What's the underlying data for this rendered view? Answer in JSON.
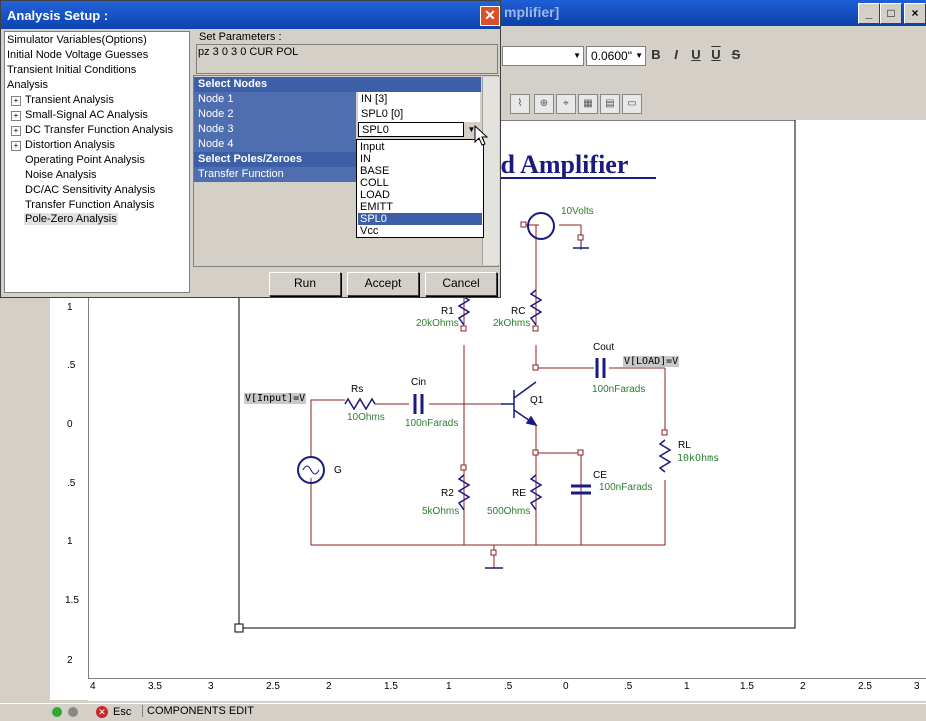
{
  "dialog": {
    "title": "Analysis Setup :",
    "close_glyph": "✕",
    "tree_items": [
      {
        "label": "Simulator Variables(Options)",
        "expandable": false
      },
      {
        "label": "Initial Node Voltage Guesses",
        "expandable": false
      },
      {
        "label": "Transient Initial Conditions",
        "expandable": false
      },
      {
        "label": "Analysis",
        "expandable": false
      },
      {
        "label": "Transient Analysis",
        "expandable": true
      },
      {
        "label": "Small-Signal AC Analysis",
        "expandable": true
      },
      {
        "label": "DC Transfer Function Analysis",
        "expandable": true
      },
      {
        "label": "Distortion Analysis",
        "expandable": true
      },
      {
        "label": "Operating Point Analysis",
        "expandable": false
      },
      {
        "label": "Noise Analysis",
        "expandable": false
      },
      {
        "label": "DC/AC Sensitivity Analysis",
        "expandable": false
      },
      {
        "label": "Transfer Function Analysis",
        "expandable": false
      },
      {
        "label": "Pole-Zero Analysis",
        "expandable": false
      }
    ],
    "set_params_label": "Set Parameters :",
    "set_params_value": "pz 3 0 3 0 CUR POL",
    "grid": {
      "select_nodes_header": "Select Nodes",
      "nodes": [
        {
          "label": "Node 1",
          "value": "IN [3]"
        },
        {
          "label": "Node 2",
          "value": "SPL0 [0]"
        },
        {
          "label": "Node 3",
          "value": "SPL0"
        },
        {
          "label": "Node 4",
          "value": ""
        }
      ],
      "poles_header": "Select Poles/Zeroes",
      "transfer_function_label": "Transfer Function"
    },
    "dropdown_options": [
      "Input",
      "IN",
      "BASE",
      "COLL",
      "LOAD",
      "EMITT",
      "SPL0",
      "Vcc"
    ],
    "dropdown_selected": "SPL0",
    "buttons": {
      "run": "Run",
      "accept": "Accept",
      "cancel": "Cancel"
    }
  },
  "editor": {
    "title_fragment": "mplifier]",
    "font_size": "0.0600\"",
    "format_buttons": [
      "B",
      "I",
      "U",
      "U",
      "S"
    ],
    "schematic_title": "ed Amplifier",
    "labels": {
      "supply": "10Volts",
      "r1_name": "R1",
      "r1_val": "20kOhms",
      "rc_name": "RC",
      "rc_val": "2kOhms",
      "cout_name": "Cout",
      "cout_val": "100nFarads",
      "vload": "V[LOAD]=V",
      "vinput": "V[Input]=V",
      "rs_name": "Rs",
      "rs_val": "10Ohms",
      "cin_name": "Cin",
      "cin_val": "100nFarads",
      "q1": "Q1",
      "rl_name": "RL",
      "rl_val": "10kOhms",
      "g": "G",
      "r2_name": "R2",
      "r2_val": "5kOhms",
      "re_name": "RE",
      "re_val": "500Ohms",
      "ce_name": "CE",
      "ce_val": "100nFarads"
    },
    "vruler": [
      "1",
      ".5",
      "0",
      ".5",
      "1",
      "1.5",
      "2"
    ],
    "hruler": [
      "4",
      "3.5",
      "3",
      "2.5",
      "2",
      "1.5",
      "1",
      ".5",
      "0",
      ".5",
      "1",
      "1.5",
      "2",
      "2.5",
      "3"
    ]
  },
  "status": {
    "esc": "Esc",
    "mode": "COMPONENTS EDIT"
  },
  "colors": {
    "title_blue": "#0c44b0",
    "grid_header": "#3c5fa8",
    "wire": "#8b2020",
    "component": "#1a1a80"
  }
}
